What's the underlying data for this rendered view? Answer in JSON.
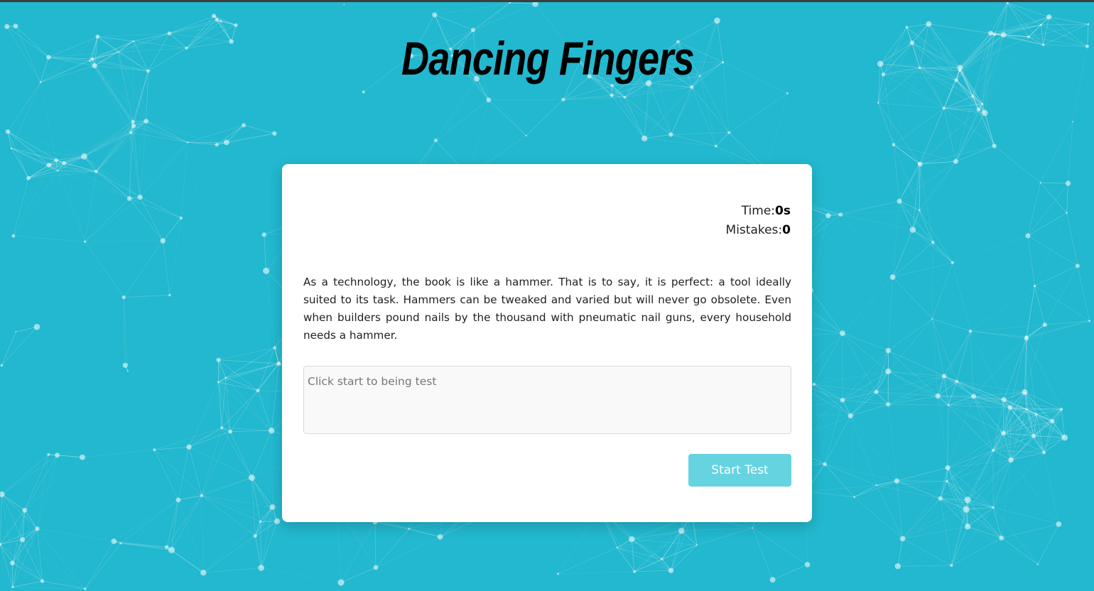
{
  "app": {
    "title": "Dancing Fingers"
  },
  "stats": {
    "time_label": "Time:",
    "time_value": "0s",
    "mistakes_label": "Mistakes:",
    "mistakes_value": "0"
  },
  "quote": {
    "text": "As a technology, the book is like a hammer. That is to say, it is perfect: a tool ideally suited to its task. Hammers can be tweaked and varied but will never go obsolete. Even when builders pound nails by the thousand with pneumatic nail guns, every household needs a hammer."
  },
  "input": {
    "value": "",
    "placeholder": "Click start to being test"
  },
  "buttons": {
    "start_label": "Start Test"
  },
  "colors": {
    "background": "#22b8cf",
    "card": "#ffffff",
    "button": "#66d3e1",
    "network_lines": "#ffffff"
  }
}
